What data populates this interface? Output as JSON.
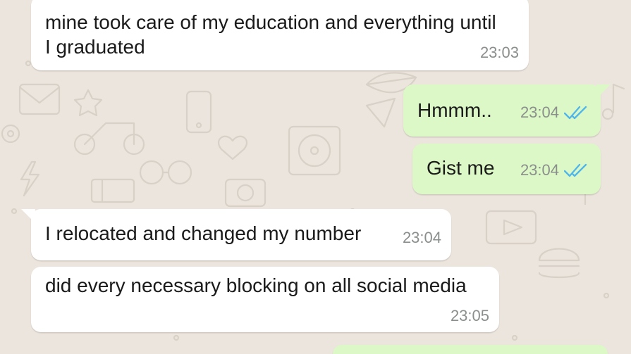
{
  "colors": {
    "background": "#ece5dd",
    "incoming_bubble": "#ffffff",
    "outgoing_bubble": "#dcf8c6",
    "read_tick": "#4fb6ec",
    "timestamp": "#8a8f8c"
  },
  "messages": [
    {
      "direction": "incoming",
      "text": "mine took care of my education and everything until\nI graduated",
      "time": "23:03"
    },
    {
      "direction": "outgoing",
      "text": "Hmmm..",
      "time": "23:04",
      "status_icon": "double-check-read-icon"
    },
    {
      "direction": "outgoing",
      "text": "Gist me",
      "time": "23:04",
      "status_icon": "double-check-read-icon"
    },
    {
      "direction": "incoming",
      "text": "I relocated and changed my number",
      "time": "23:04"
    },
    {
      "direction": "incoming",
      "text": "did every necessary blocking on all social media",
      "time": "23:05"
    }
  ]
}
